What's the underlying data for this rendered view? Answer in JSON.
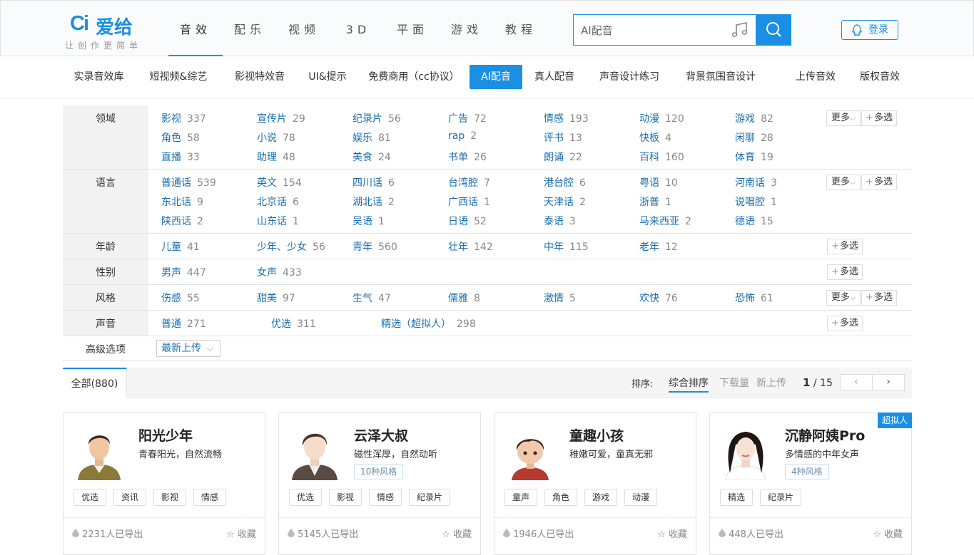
{
  "logo": {
    "mark": "Ci",
    "brand": "爱给",
    "slogan": "让创作更简单"
  },
  "mainnav": [
    "音效",
    "配乐",
    "视频",
    "3D",
    "平面",
    "游戏",
    "教程"
  ],
  "search": {
    "value": "AI配音"
  },
  "login": "登录",
  "subnav": [
    "实录音效库",
    "短视频&综艺",
    "影视特效音",
    "UI&提示",
    "免费商用（cc协议）",
    "AI配音",
    "真人配音",
    "声音设计练习",
    "背景氛围音设计",
    "上传音效",
    "版权音效"
  ],
  "filters": [
    {
      "label": "领域",
      "more": true,
      "rows": [
        [
          [
            "影视",
            "337"
          ],
          [
            "宣传片",
            "29"
          ],
          [
            "纪录片",
            "56"
          ],
          [
            "广告",
            "72"
          ],
          [
            "情感",
            "193"
          ],
          [
            "动漫",
            "120"
          ],
          [
            "游戏",
            "82"
          ]
        ],
        [
          [
            "角色",
            "58"
          ],
          [
            "小说",
            "78"
          ],
          [
            "娱乐",
            "81"
          ],
          [
            "rap",
            "2"
          ],
          [
            "评书",
            "13"
          ],
          [
            "快板",
            "4"
          ],
          [
            "闲聊",
            "28"
          ]
        ],
        [
          [
            "直播",
            "33"
          ],
          [
            "助理",
            "48"
          ],
          [
            "美食",
            "24"
          ],
          [
            "书单",
            "26"
          ],
          [
            "朗诵",
            "22"
          ],
          [
            "百科",
            "160"
          ],
          [
            "体育",
            "19"
          ]
        ]
      ]
    },
    {
      "label": "语言",
      "more": true,
      "rows": [
        [
          [
            "普通话",
            "539"
          ],
          [
            "英文",
            "154"
          ],
          [
            "四川话",
            "6"
          ],
          [
            "台湾腔",
            "7"
          ],
          [
            "港台腔",
            "6"
          ],
          [
            "粤语",
            "10"
          ],
          [
            "河南话",
            "3"
          ]
        ],
        [
          [
            "东北话",
            "9"
          ],
          [
            "北京话",
            "6"
          ],
          [
            "湖北话",
            "2"
          ],
          [
            "广西话",
            "1"
          ],
          [
            "天津话",
            "2"
          ],
          [
            "浙普",
            "1"
          ],
          [
            "说唱腔",
            "1"
          ]
        ],
        [
          [
            "陕西话",
            "2"
          ],
          [
            "山东话",
            "1"
          ],
          [
            "吴语",
            "1"
          ],
          [
            "日语",
            "52"
          ],
          [
            "泰语",
            "3"
          ],
          [
            "马来西亚",
            "2"
          ],
          [
            "德语",
            "15"
          ]
        ]
      ]
    },
    {
      "label": "年龄",
      "more": false,
      "rows": [
        [
          [
            "儿童",
            "41"
          ],
          [
            "少年、少女",
            "56"
          ],
          [
            "青年",
            "560"
          ],
          [
            "壮年",
            "142"
          ],
          [
            "中年",
            "115"
          ],
          [
            "老年",
            "12"
          ]
        ]
      ]
    },
    {
      "label": "性别",
      "more": false,
      "rows": [
        [
          [
            "男声",
            "447"
          ],
          [
            "女声",
            "433"
          ]
        ]
      ]
    },
    {
      "label": "风格",
      "more": true,
      "rows": [
        [
          [
            "伤感",
            "55"
          ],
          [
            "甜美",
            "97"
          ],
          [
            "生气",
            "47"
          ],
          [
            "儒雅",
            "8"
          ],
          [
            "激情",
            "5"
          ],
          [
            "欢快",
            "76"
          ],
          [
            "恐怖",
            "61"
          ]
        ]
      ]
    },
    {
      "label": "声音",
      "more": false,
      "wide": true,
      "rows": [
        [
          [
            "普通",
            "271"
          ],
          [
            "优选",
            "311"
          ],
          [
            "精选（超拟人）",
            "298"
          ]
        ]
      ]
    }
  ],
  "more_label": "更多",
  "multi_label": "多选",
  "advanced": {
    "label": "高级选项",
    "select": "最新上传"
  },
  "tab_all": "全部(880)",
  "sort": {
    "label": "排序:",
    "options": [
      "综合排序",
      "下载量",
      "新上传"
    ]
  },
  "pager": {
    "current": "1",
    "total": "/ 15"
  },
  "cards": [
    {
      "name": "阳光少年",
      "desc": "青春阳光，自然流畅",
      "styles": "",
      "tags": [
        "优选",
        "资讯",
        "影视",
        "情感"
      ],
      "exports": "2231人已导出",
      "fav": "收藏",
      "badge": ""
    },
    {
      "name": "云泽大叔",
      "desc": "磁性浑厚，自然动听",
      "styles": "10种风格",
      "tags": [
        "优选",
        "影视",
        "情感",
        "纪录片"
      ],
      "exports": "5145人已导出",
      "fav": "收藏",
      "badge": ""
    },
    {
      "name": "童趣小孩",
      "desc": "稚嫩可爱，童真无邪",
      "styles": "",
      "tags": [
        "童声",
        "角色",
        "游戏",
        "动漫"
      ],
      "exports": "1946人已导出",
      "fav": "收藏",
      "badge": ""
    },
    {
      "name": "沉静阿姨Pro",
      "desc": "多情感的中年女声",
      "styles": "4种风格",
      "tags": [
        "精选",
        "纪录片"
      ],
      "exports": "448人已导出",
      "fav": "收藏",
      "badge": "超拟人"
    }
  ]
}
